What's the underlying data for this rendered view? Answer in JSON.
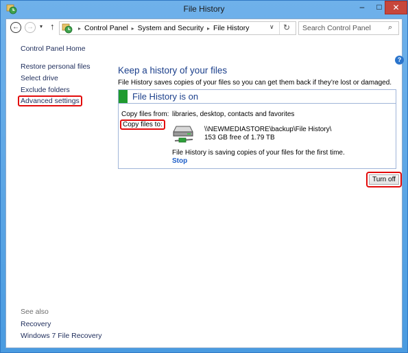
{
  "window": {
    "title": "File History",
    "minimize_glyph": "–",
    "maximize_glyph": "□",
    "close_glyph": "✕"
  },
  "navbar": {
    "back_glyph": "←",
    "forward_glyph": "→",
    "recent_glyph": "▾",
    "up_glyph": "↑",
    "breadcrumb": [
      "Control Panel",
      "System and Security",
      "File History"
    ],
    "crumb_separator": "▸",
    "dropdown_glyph": "∨",
    "refresh_glyph": "↻",
    "search_placeholder": "Search Control Panel",
    "search_value": "",
    "search_glyph": "⌕"
  },
  "sidebar": {
    "home_link": "Control Panel Home",
    "links": [
      "Restore personal files",
      "Select drive",
      "Exclude folders",
      "Advanced settings"
    ],
    "see_also_label": "See also",
    "see_also_links": [
      "Recovery",
      "Windows 7 File Recovery"
    ]
  },
  "main": {
    "help_glyph": "?",
    "heading": "Keep a history of your files",
    "description": "File History saves copies of your files so you can get them back if they’re lost or damaged.",
    "status_title": "File History is on",
    "status_color": "#1f9a2e",
    "copy_from_label": "Copy files from:",
    "copy_from_value": "libraries, desktop, contacts and favorites",
    "copy_to_label": "Copy files to:",
    "destination_path": "\\\\NEWMEDIASTORE\\backup\\File History\\",
    "destination_free": "153 GB free of 1.79 TB",
    "progress_message": "File History is saving copies of your files for the first time.",
    "stop_link": "Stop",
    "turn_off_button": "Turn off"
  },
  "highlight_color": "#e20a0a"
}
